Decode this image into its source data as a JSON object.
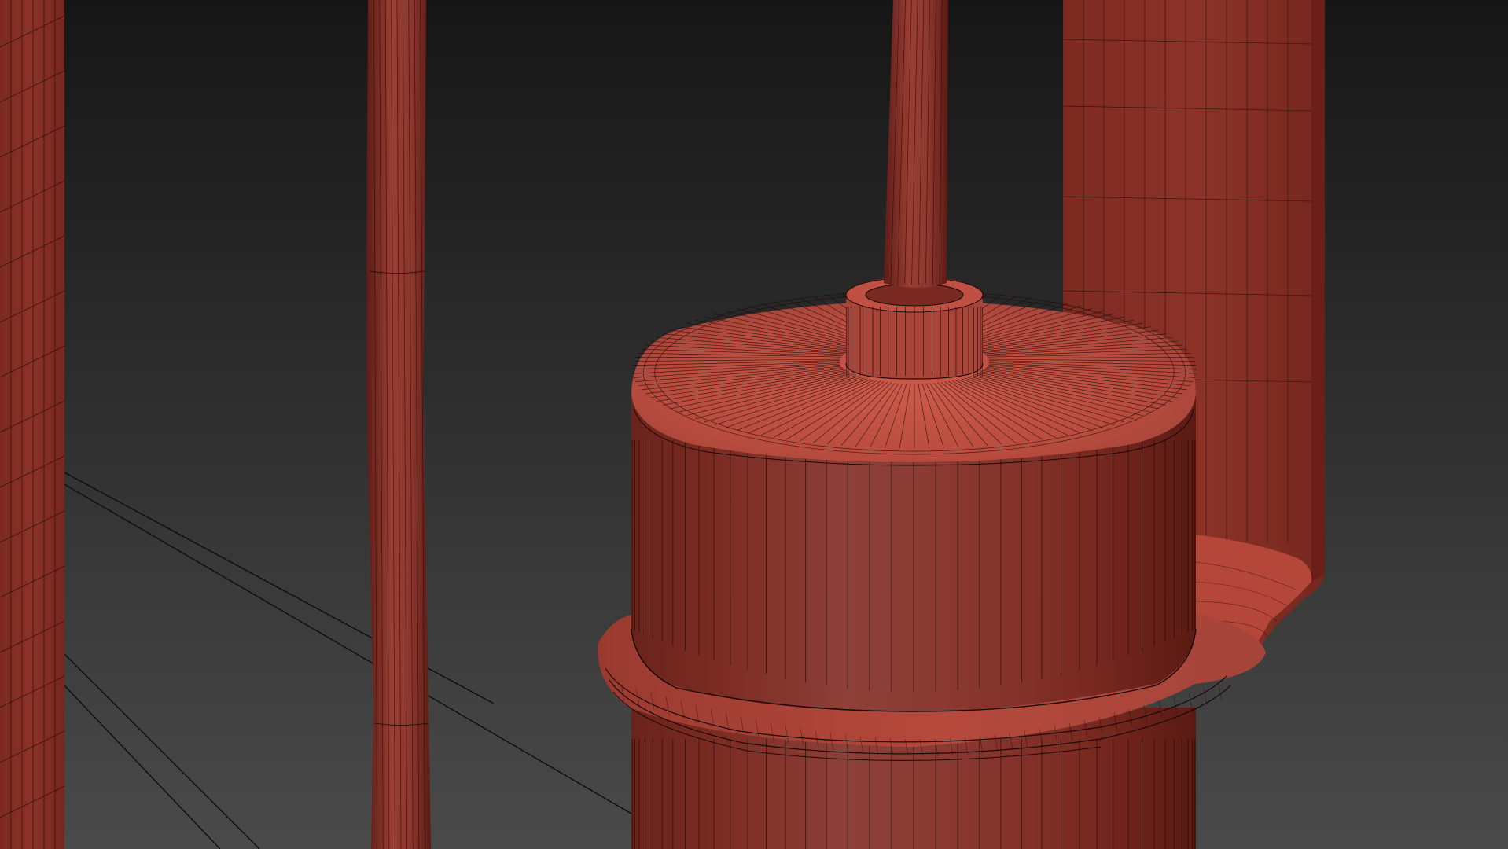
{
  "viewport": {
    "background_top": "#161616",
    "background_bottom": "#4a4a4a",
    "mesh_color": "#8a3329",
    "mesh_highlight": "#c25446",
    "mesh_shadow": "#5e1c16",
    "wire_color": "#1a0806",
    "ground_line_color": "#0e0e0e",
    "shading_mode": "shaded-with-wireframe",
    "view": "perspective"
  }
}
